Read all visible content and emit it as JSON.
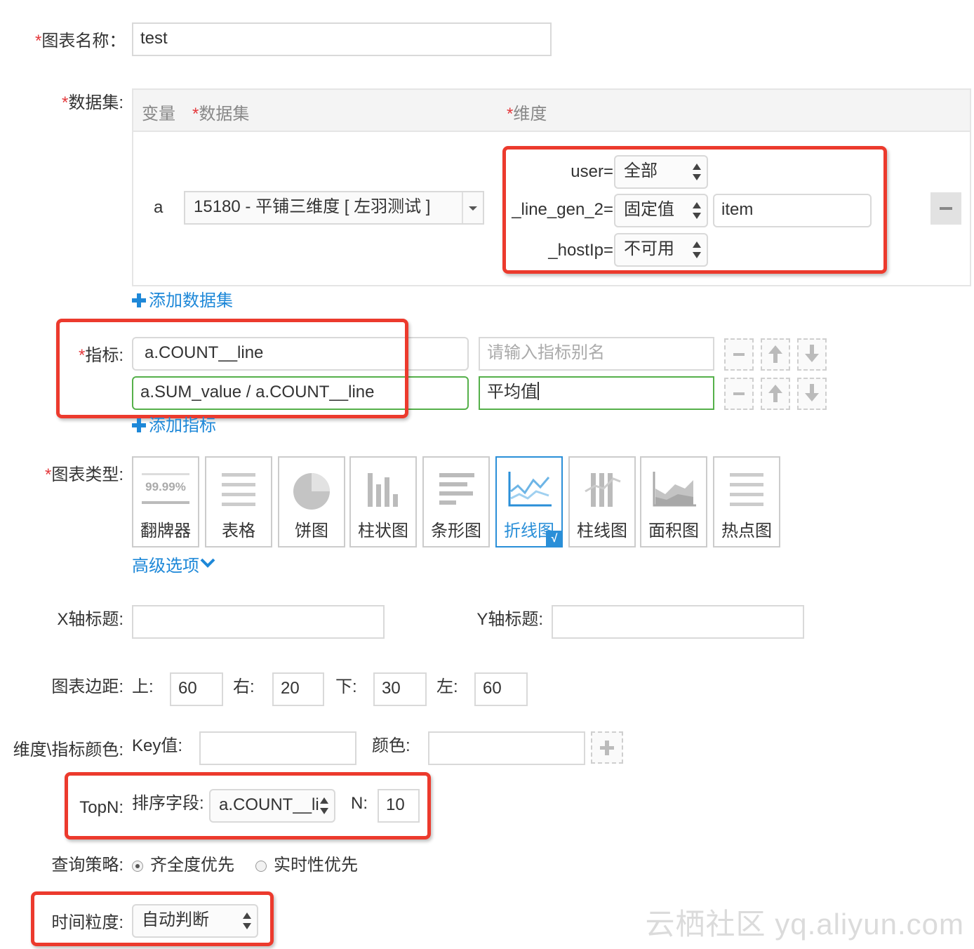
{
  "chart_name": {
    "req": "*",
    "label": "图表名称：",
    "value": "test"
  },
  "dataset": {
    "req": "*",
    "label": "数据集:",
    "col_variable": "变量",
    "col_dataset_req": "*",
    "col_dataset": "数据集",
    "col_dimension_req": "*",
    "col_dimension": "维度",
    "row_variable": "a",
    "row_dataset_value": "15180 - 平铺三维度 [ 左羽测试 ]",
    "dimensions": [
      {
        "key": "user=",
        "value": "全部"
      },
      {
        "key": "_line_gen_2=",
        "value": "固定值",
        "extra": "item"
      },
      {
        "key": "_hostIp=",
        "value": "不可用"
      }
    ],
    "add_link": "添加数据集"
  },
  "metrics": {
    "req": "*",
    "label": "指标:",
    "rows": [
      {
        "expr": "a.COUNT__line",
        "alias": "",
        "alias_placeholder": "请输入指标别名"
      },
      {
        "expr": "a.SUM_value / a.COUNT__line",
        "alias": "平均值"
      }
    ],
    "add_link": "添加指标"
  },
  "chart_type": {
    "req": "*",
    "label": "图表类型:",
    "options": [
      {
        "label": "翻牌器",
        "icon": "flipper-icon",
        "sample": "99.99%"
      },
      {
        "label": "表格",
        "icon": "table-icon"
      },
      {
        "label": "饼图",
        "icon": "pie-chart-icon"
      },
      {
        "label": "柱状图",
        "icon": "column-chart-icon"
      },
      {
        "label": "条形图",
        "icon": "bar-chart-icon"
      },
      {
        "label": "折线图",
        "icon": "line-chart-icon",
        "selected": true
      },
      {
        "label": "柱线图",
        "icon": "column-line-chart-icon"
      },
      {
        "label": "面积图",
        "icon": "area-chart-icon"
      },
      {
        "label": "热点图",
        "icon": "heatmap-icon"
      }
    ],
    "selected_mark": "√",
    "advanced_link": "高级选项"
  },
  "axis": {
    "x_label": "X轴标题:",
    "x_value": "",
    "y_label": "Y轴标题:",
    "y_value": ""
  },
  "margins": {
    "label": "图表边距:",
    "top_label": "上:",
    "top": "60",
    "right_label": "右:",
    "right": "20",
    "bottom_label": "下:",
    "bottom": "30",
    "left_label": "左:",
    "left": "60"
  },
  "colors": {
    "label": "维度\\指标颜色:",
    "key_label": "Key值:",
    "key_value": "",
    "color_label": "颜色:",
    "color_value": ""
  },
  "topn": {
    "label": "TopN:",
    "sort_label": "排序字段:",
    "sort_value": "a.COUNT__li",
    "n_label": "N:",
    "n_value": "10"
  },
  "query_strategy": {
    "label": "查询策略:",
    "option1": "齐全度优先",
    "option2": "实时性优先",
    "selected": 1
  },
  "time_granularity": {
    "label": "时间粒度:",
    "value": "自动判断"
  },
  "watermark": "云栖社区 yq.aliyun.com",
  "colors_theme": {
    "accent": "#1e88d8",
    "highlight_red": "#ec3a2d",
    "valid_green": "#55b04a"
  }
}
